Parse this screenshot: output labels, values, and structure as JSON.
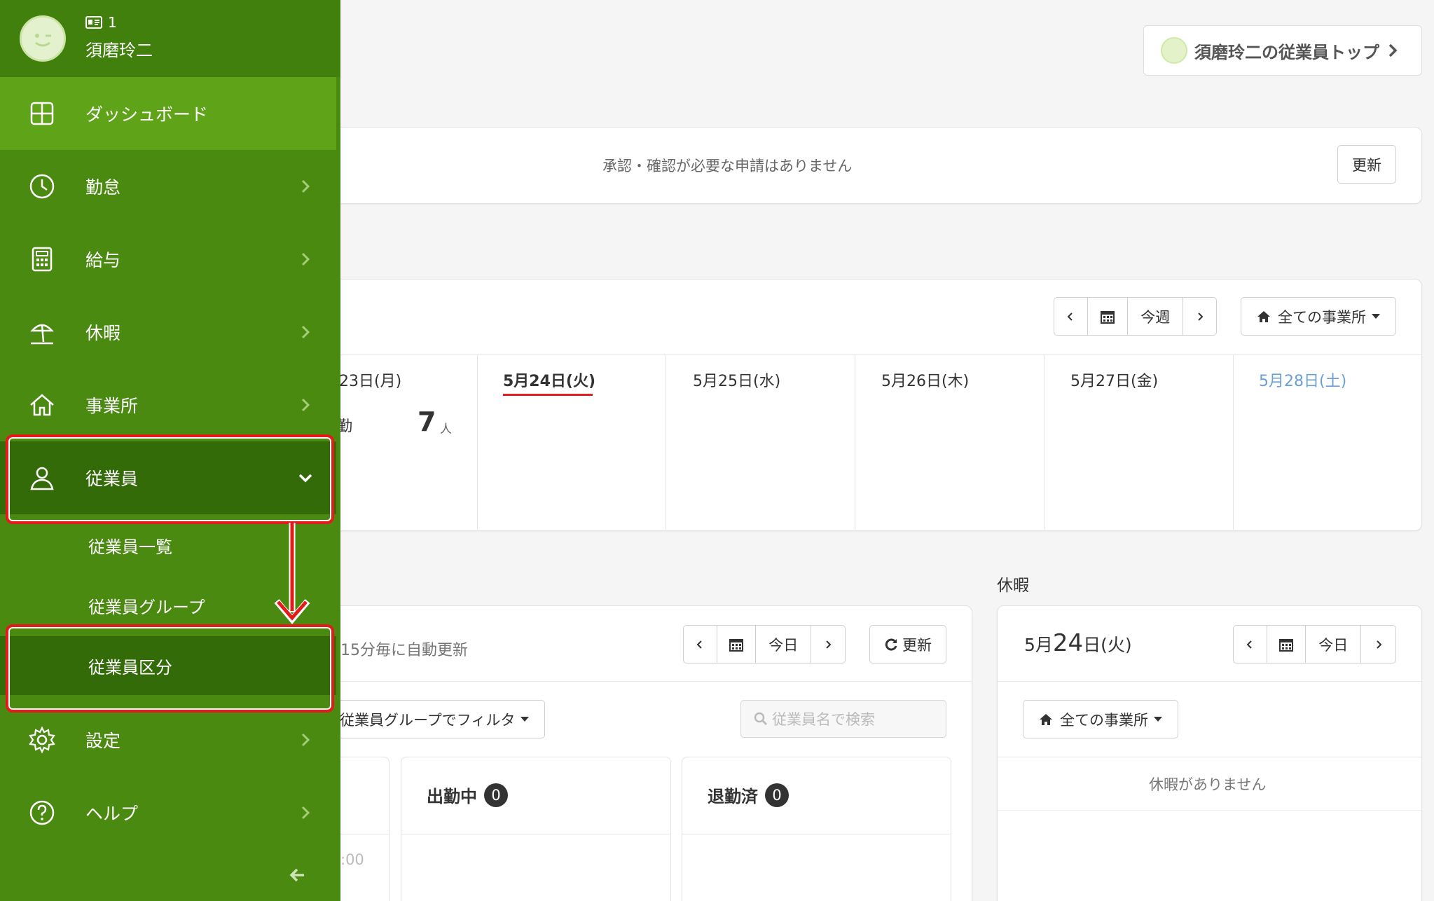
{
  "user": {
    "id": "1",
    "name": "須磨玲二"
  },
  "nav": {
    "dashboard": "ダッシュボード",
    "attendance": "勤怠",
    "payroll": "給与",
    "leave": "休暇",
    "office": "事業所",
    "employee": "従業員",
    "employee_sub": [
      "従業員一覧",
      "従業員グループ",
      "従業員区分"
    ],
    "settings": "設定",
    "help": "ヘルプ"
  },
  "header": {
    "employee_top": "須磨玲二の従業員トップ"
  },
  "approvals": {
    "message": "承認・確認が必要な申請はありません",
    "refresh": "更新"
  },
  "week": {
    "this_week": "今週",
    "office_filter": "全ての事業所",
    "days": [
      "23日(月)",
      "5月24日(火)",
      "5月25日(水)",
      "5月26日(木)",
      "5月27日(金)",
      "5月28日(土)"
    ],
    "partial_left": "勤",
    "count": "7",
    "count_unit": "人"
  },
  "timecard": {
    "auto_refresh": "15分毎に自動更新",
    "today": "今日",
    "refresh": "更新",
    "group_filter": "従業員グループでフィルタ",
    "search_placeholder": "従業員名で検索",
    "working_label": "出勤中",
    "working_count": "0",
    "left_label": "退勤済",
    "left_count": "0",
    "partial_time": ":00"
  },
  "leave_panel": {
    "title": "休暇",
    "date_prefix": "5月",
    "date_day": "24",
    "date_suffix": "日(火)",
    "today": "今日",
    "office_filter": "全ての事業所",
    "empty": "休暇がありません"
  },
  "colors": {
    "sidebar": "#4a8a10",
    "active": "#5fa318",
    "open": "#336b08",
    "highlight": "#e31b1b",
    "today_underline": "#e02020",
    "saturday": "#6a9fd6"
  }
}
